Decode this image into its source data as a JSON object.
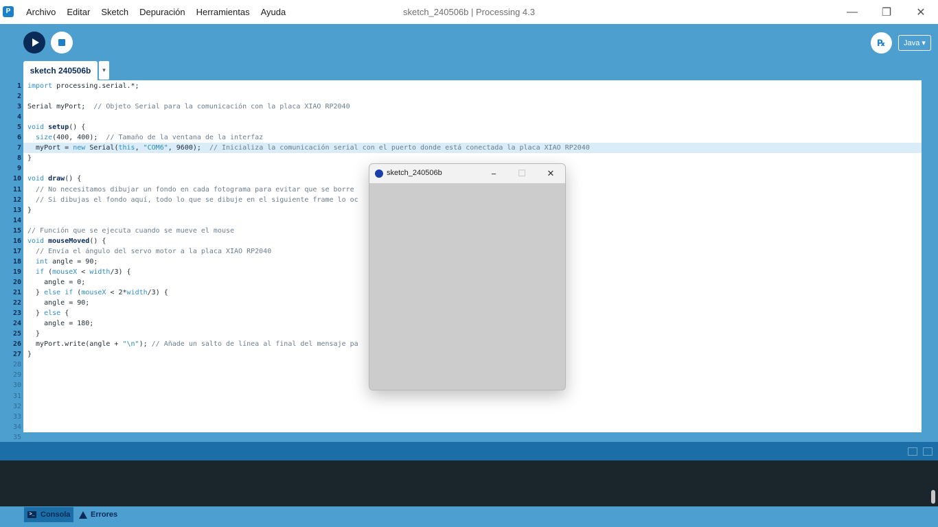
{
  "window": {
    "title": "sketch_240506b | Processing 4.3",
    "menu": [
      "Archivo",
      "Editar",
      "Sketch",
      "Depuración",
      "Herramientas",
      "Ayuda"
    ],
    "minimize_icon": "minimize-icon",
    "maximize_icon": "restore-icon",
    "close_icon": "close-icon"
  },
  "toolbar": {
    "run_icon": "play-icon",
    "stop_icon": "stop-icon",
    "debug_icon": "debugger-icon",
    "mode_label": "Java ▾"
  },
  "tab": {
    "name": "sketch 240506b",
    "menu_icon": "▾"
  },
  "editor": {
    "highlight_line": 7,
    "line_numbers": [
      "1",
      "2",
      "3",
      "4",
      "5",
      "6",
      "7",
      "8",
      "9",
      "10",
      "11",
      "12",
      "13",
      "14",
      "15",
      "16",
      "17",
      "18",
      "19",
      "20",
      "21",
      "22",
      "23",
      "24",
      "25",
      "26",
      "27",
      "28",
      "29",
      "30",
      "31",
      "32",
      "33",
      "34",
      "35"
    ],
    "lines": [
      "import processing.serial.*;",
      "",
      "Serial myPort;  // Objeto Serial para la comunicación con la placa XIAO RP2040",
      "",
      "void setup() {",
      "  size(400, 400);  // Tamaño de la ventana de la interfaz",
      "  myPort = new Serial(this, \"COM6\", 9600);  // Inicializa la comunicación serial con el puerto donde está conectada la placa XIAO RP2040",
      "}",
      "",
      "void draw() {",
      "  // No necesitamos dibujar un fondo en cada fotograma para evitar que se borre",
      "  // Si dibujas el fondo aquí, todo lo que se dibuje en el siguiente frame lo oc",
      "}",
      "",
      "// Función que se ejecuta cuando se mueve el mouse",
      "void mouseMoved() {",
      "  // Envía el ángulo del servo motor a la placa XIAO RP2040",
      "  int angle = 90;",
      "  if (mouseX < width/3) {",
      "    angle = 0;",
      "  } else if (mouseX < 2*width/3) {",
      "    angle = 90;",
      "  } else {",
      "    angle = 180;",
      "  }",
      "  myPort.write(angle + \"\\n\"); // Añade un salto de línea al final del mensaje pa",
      "}",
      "",
      "",
      "",
      "",
      "",
      "",
      "",
      ""
    ]
  },
  "console": {
    "tabs": [
      "Consola",
      "Errores"
    ],
    "console_icon": "terminal-icon",
    "errors_icon": "warning-icon"
  },
  "sketch_window": {
    "title": "sketch_240506b",
    "minimize": "−",
    "maximize": "☐",
    "close": "✕"
  }
}
